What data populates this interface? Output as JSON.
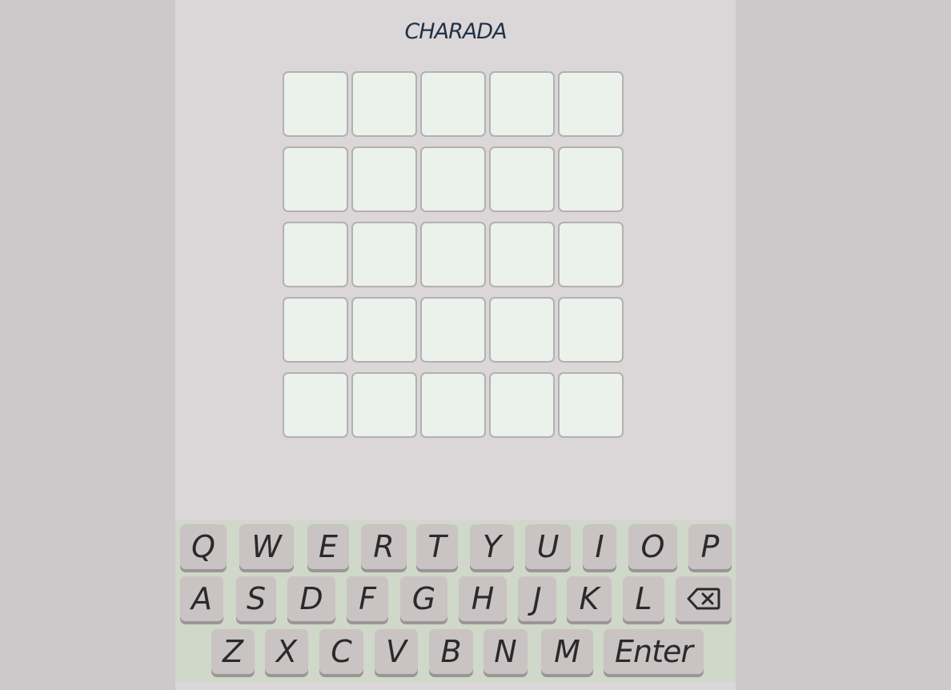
{
  "title": "CHARADA",
  "board": {
    "rows": 5,
    "cols": 5,
    "tiles": [
      [
        "",
        "",
        "",
        "",
        ""
      ],
      [
        "",
        "",
        "",
        "",
        ""
      ],
      [
        "",
        "",
        "",
        "",
        ""
      ],
      [
        "",
        "",
        "",
        "",
        ""
      ],
      [
        "",
        "",
        "",
        "",
        ""
      ]
    ]
  },
  "keyboard": {
    "row1": [
      "Q",
      "W",
      "E",
      "R",
      "T",
      "Y",
      "U",
      "I",
      "O",
      "P"
    ],
    "row2": [
      "A",
      "S",
      "D",
      "F",
      "G",
      "H",
      "J",
      "K",
      "L"
    ],
    "row3": [
      "Z",
      "X",
      "C",
      "V",
      "B",
      "N",
      "M"
    ],
    "enter_label": "Enter",
    "backspace_icon": "backspace-icon"
  }
}
